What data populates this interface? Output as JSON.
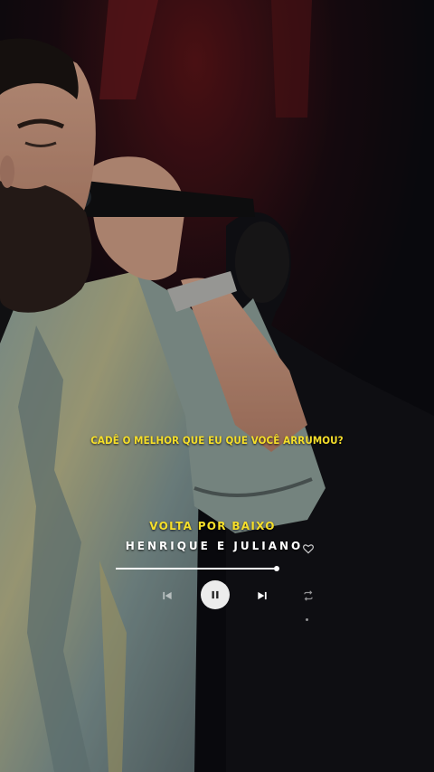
{
  "player": {
    "lyric_line": "CADÊ O MELHOR QUE EU QUE VOCÊ ARRUMOU?",
    "song_title": "VOLTA POR BAIXO",
    "artist": "HENRIQUE E JULIANO",
    "progress_fraction": 1.0,
    "state": "playing"
  },
  "icons": {
    "like": "heart-outline-icon",
    "previous": "skip-previous-icon",
    "play_pause": "pause-icon",
    "next": "skip-next-icon",
    "repeat": "repeat-icon"
  },
  "colors": {
    "lyric": "#f6df2a",
    "title": "#f6df2a",
    "artist": "#ffffff",
    "play_button": "#ececec"
  }
}
